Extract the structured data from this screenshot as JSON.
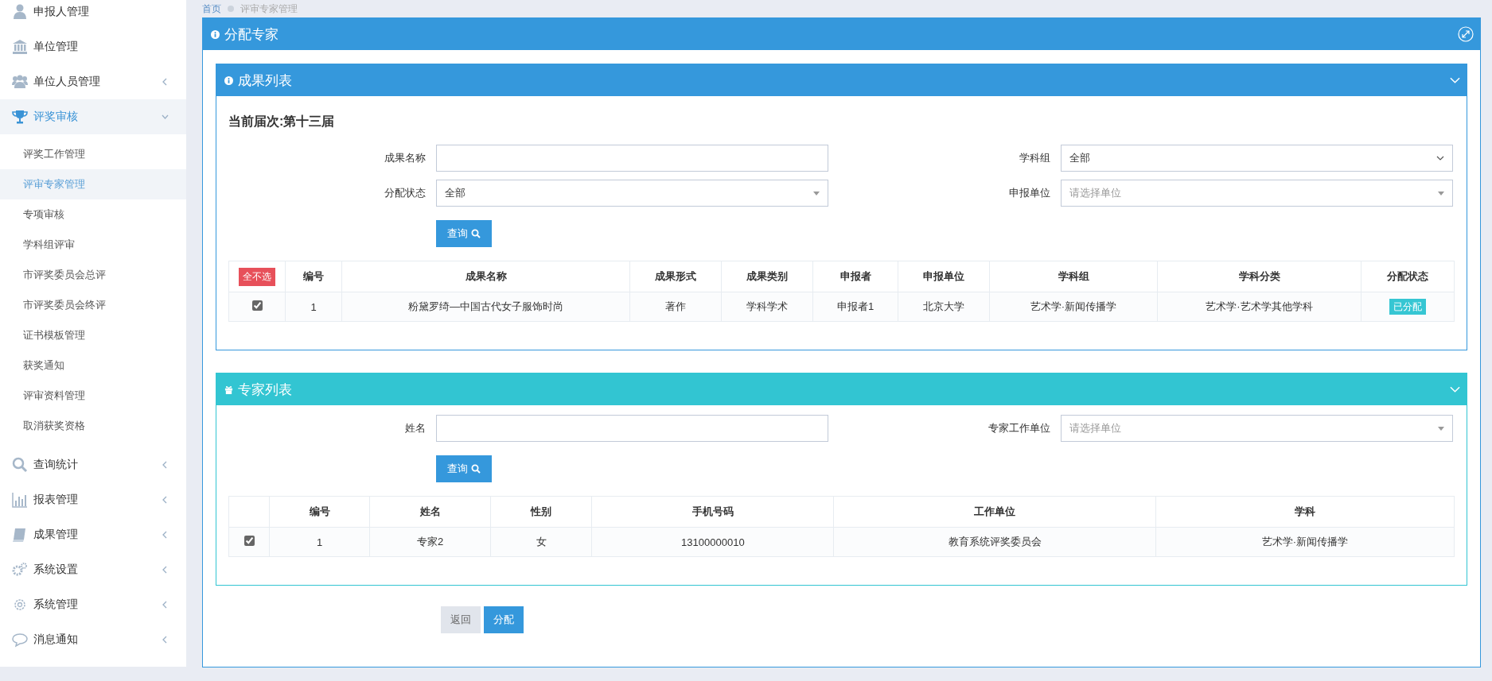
{
  "breadcrumb": [
    "首页",
    "评审专家管理"
  ],
  "sidebar": {
    "items": [
      {
        "label": "申报人管理",
        "selected": false
      },
      {
        "label": "单位管理",
        "selected": false
      },
      {
        "label": "单位人员管理",
        "selected": false,
        "expanded": false
      },
      {
        "label": "评奖审核",
        "selected": true,
        "expanded": true,
        "children": [
          {
            "label": "评奖工作管理",
            "selected": false
          },
          {
            "label": "评审专家管理",
            "selected": true
          },
          {
            "label": "专项审核",
            "selected": false
          },
          {
            "label": "学科组评审",
            "selected": false
          },
          {
            "label": "市评奖委员会总评",
            "selected": false
          },
          {
            "label": "市评奖委员会终评",
            "selected": false
          },
          {
            "label": "证书模板管理",
            "selected": false
          },
          {
            "label": "获奖通知",
            "selected": false
          },
          {
            "label": "评审资料管理",
            "selected": false
          },
          {
            "label": "取消获奖资格",
            "selected": false
          }
        ]
      },
      {
        "label": "查询统计",
        "selected": false,
        "expanded": false
      },
      {
        "label": "报表管理",
        "selected": false,
        "expanded": false
      },
      {
        "label": "成果管理",
        "selected": false,
        "expanded": false
      },
      {
        "label": "系统设置",
        "selected": false,
        "expanded": false
      },
      {
        "label": "系统管理",
        "selected": false,
        "expanded": false
      },
      {
        "label": "消息通知",
        "selected": false,
        "expanded": false
      }
    ]
  },
  "main_panel": {
    "title": "分配专家",
    "results_panel": {
      "title": "成果列表",
      "session": "当前届次:第十三届",
      "fields": [
        {
          "label": "成果名称",
          "kind": "input"
        },
        {
          "label": "学科组",
          "kind": "select",
          "value": "全部"
        },
        {
          "label": "分配状态",
          "kind": "dropdown",
          "value": "全部"
        },
        {
          "label": "申报单位",
          "kind": "dropdown",
          "placeholder": "请选择单位"
        }
      ],
      "query_button": "查询",
      "table": {
        "select_all_button": "全不选",
        "columns": [
          "编号",
          "成果名称",
          "成果形式",
          "成果类别",
          "申报者",
          "申报单位",
          "学科组",
          "学科分类",
          "分配状态"
        ],
        "rows": [
          {
            "checked": true,
            "cells": [
              "1",
              "粉黛罗绮—中国古代女子服饰时尚",
              "著作",
              "学科学术",
              "申报者1",
              "北京大学",
              "艺术学·新闻传播学",
              "艺术学·艺术学其他学科"
            ],
            "status": "已分配"
          }
        ]
      }
    },
    "experts_panel": {
      "title": "专家列表",
      "fields": [
        {
          "label": "姓名",
          "kind": "input"
        },
        {
          "label": "专家工作单位",
          "kind": "dropdown",
          "placeholder": "请选择单位"
        }
      ],
      "query_button": "查询",
      "table": {
        "columns": [
          "编号",
          "姓名",
          "性别",
          "手机号码",
          "工作单位",
          "学科"
        ],
        "rows": [
          {
            "checked": true,
            "cells": [
              "1",
              "专家2",
              "女",
              "13100000010",
              "教育系统评奖委员会",
              "艺术学·新闻传播学"
            ]
          }
        ]
      }
    },
    "buttons": [
      {
        "label": "返回",
        "kind": "default"
      },
      {
        "label": "分配",
        "kind": "primary"
      }
    ]
  }
}
